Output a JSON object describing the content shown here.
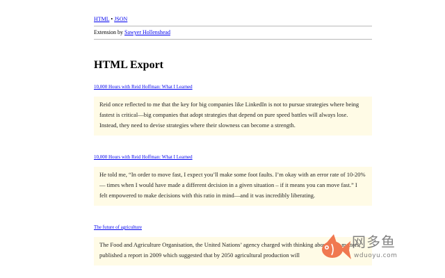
{
  "nav": {
    "html_label": "HTML",
    "separator": "•",
    "json_label": "JSON"
  },
  "byline": {
    "prefix": "Extension by ",
    "author": "Sawyer Hollenshead"
  },
  "page_title": "HTML Export",
  "entries": [
    {
      "source": "10,000 Hours with Reid Hoffman: What I Learned",
      "quote": "Reid once reflected to me that the key for big companies like LinkedIn is not to pursue strategies where being fastest is critical—big companies that adopt strategies that depend on pure speed battles will always lose. Instead, they need to devise strategies where their slowness can become a strength."
    },
    {
      "source": "10,000 Hours with Reid Hoffman: What I Learned",
      "quote": "He told me, “In order to move fast, I expect you’ll make some foot faults. I’m okay with an error rate of 10-20% — times when I would have made a different decision in a given situation – if it means you can move fast.” I felt empowered to make decisions with this ratio in mind—and it was incredibly liberating."
    },
    {
      "source": "The future of agriculture",
      "quote": "The Food and Agriculture Organisation, the United Nations’ agency charged with thinking about such matters, published a report in 2009 which suggested that by 2050 agricultural production will"
    }
  ],
  "watermark": {
    "brand_cn": "网多鱼",
    "brand_url": "wduoyu.com",
    "logo_color": "#f07850",
    "logo_icon": "fish-logo-icon"
  },
  "colors": {
    "link": "#0000ee",
    "quote_bg": "#fffbe6",
    "rule": "#b8b8b8"
  }
}
